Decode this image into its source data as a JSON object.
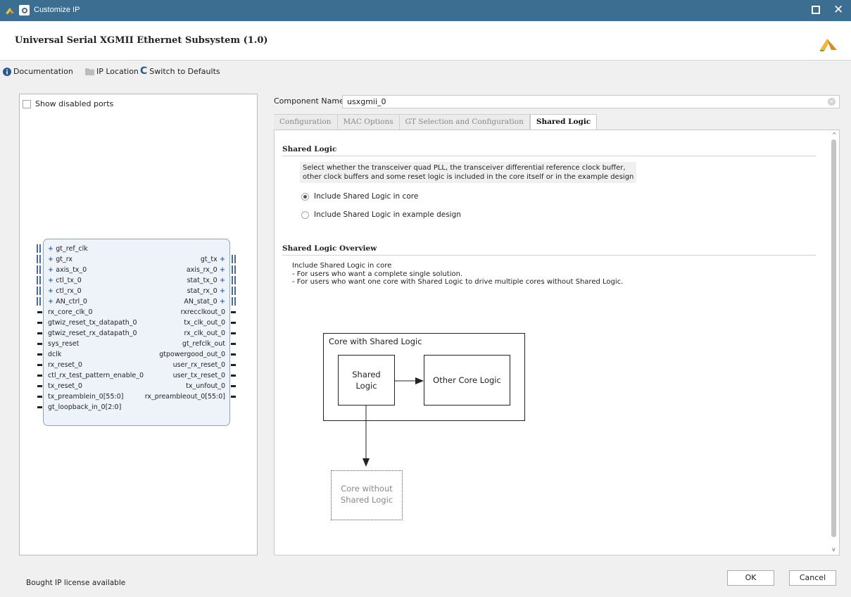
{
  "window": {
    "title": "Customize IP"
  },
  "header": {
    "title": "Universal Serial XGMII Ethernet Subsystem (1.0)"
  },
  "toolbar": {
    "documentation": "Documentation",
    "ip_location": "IP Location",
    "switch_defaults": "Switch to Defaults"
  },
  "left": {
    "show_disabled": "Show disabled ports",
    "ports_left": [
      "gt_ref_clk",
      "gt_rx",
      "axis_tx_0",
      "ctl_tx_0",
      "ctl_rx_0",
      "AN_ctrl_0",
      "rx_core_clk_0",
      "gtwiz_reset_tx_datapath_0",
      "gtwiz_reset_rx_datapath_0",
      "sys_reset",
      "dclk",
      "rx_reset_0",
      "ctl_rx_test_pattern_enable_0",
      "tx_reset_0",
      "tx_preamblein_0[55:0]",
      "gt_loopback_in_0[2:0]"
    ],
    "ports_right": [
      "gt_tx",
      "axis_rx_0",
      "stat_tx_0",
      "stat_rx_0",
      "AN_stat_0",
      "rxrecclkout_0",
      "tx_clk_out_0",
      "rx_clk_out_0",
      "gt_refclk_out",
      "gtpowergood_out_0",
      "user_rx_reset_0",
      "user_tx_reset_0",
      "tx_unfout_0",
      "rx_preambleout_0[55:0]"
    ]
  },
  "component": {
    "label": "Component Name",
    "value": "usxgmii_0"
  },
  "tabs": [
    "Configuration",
    "MAC Options",
    "GT Selection and Configuration",
    "Shared Logic"
  ],
  "shared": {
    "title": "Shared Logic",
    "desc_line1": "Select whether the transceiver quad PLL, the transceiver differential reference clock buffer,",
    "desc_line2": "other clock buffers and some reset logic is included in the core itself or in the example design",
    "option1": "Include Shared Logic in core",
    "option2": "Include Shared Logic in example design",
    "selected": 0
  },
  "overview": {
    "title": "Shared Logic Overview",
    "line1": "Include Shared Logic in core",
    "line2": "- For users who want a complete single solution.",
    "line3": "- For users who want one core with Shared Logic to drive multiple cores without Shared Logic."
  },
  "diagram": {
    "outer": "Core with Shared Logic",
    "shared_l1": "Shared",
    "shared_l2": "Logic",
    "other": "Other Core Logic",
    "without_l1": "Core without",
    "without_l2": "Shared Logic"
  },
  "footer": {
    "license": "Bought IP license available",
    "ok": "OK",
    "cancel": "Cancel"
  },
  "colors": {
    "titlebar": "#3b6e90",
    "symbol_fill": "#eef3fa",
    "symbol_border": "#8aa5c8"
  }
}
